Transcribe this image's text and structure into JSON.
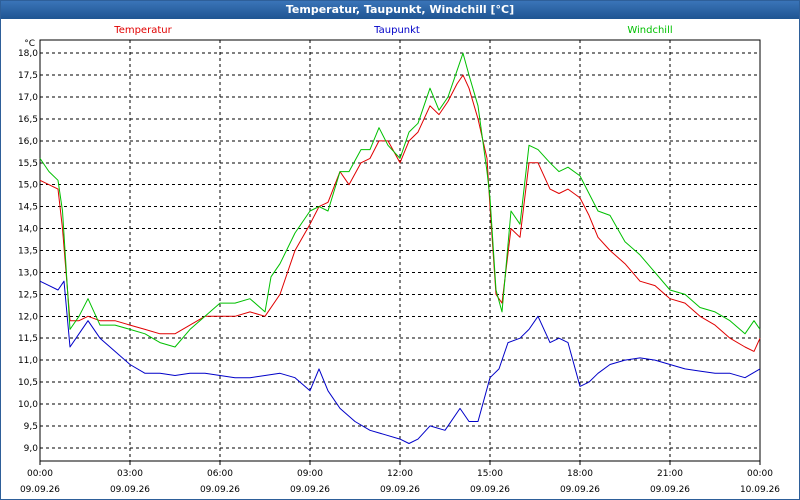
{
  "window": {
    "title": "Temperatur, Taupunkt, Windchill [°C]"
  },
  "chart_data": {
    "type": "line",
    "title": "Temperatur, Taupunkt, Windchill [°C]",
    "ylabel": "°C",
    "ylim": [
      8.7,
      18.3
    ],
    "yticks": [
      "9,0",
      "9,5",
      "10,0",
      "10,5",
      "11,0",
      "11,5",
      "12,0",
      "12,5",
      "13,0",
      "13,5",
      "14,0",
      "14,5",
      "15,0",
      "15,5",
      "16,0",
      "16,5",
      "17,0",
      "17,5",
      "18,0"
    ],
    "xlim": [
      0,
      24
    ],
    "xticks": [
      {
        "hour": 0,
        "time": "00:00",
        "date": "09.09.26"
      },
      {
        "hour": 3,
        "time": "03:00",
        "date": "09.09.26"
      },
      {
        "hour": 6,
        "time": "06:00",
        "date": "09.09.26"
      },
      {
        "hour": 9,
        "time": "09:00",
        "date": "09.09.26"
      },
      {
        "hour": 12,
        "time": "12:00",
        "date": "09.09.26"
      },
      {
        "hour": 15,
        "time": "15:00",
        "date": "09.09.26"
      },
      {
        "hour": 18,
        "time": "18:00",
        "date": "09.09.26"
      },
      {
        "hour": 21,
        "time": "21:00",
        "date": "09.09.26"
      },
      {
        "hour": 24,
        "time": "00:00",
        "date": "10.09.26"
      }
    ],
    "grid": true,
    "legend_placement": "top",
    "series": [
      {
        "name": "Temperatur",
        "color": "#e00000",
        "x": [
          0,
          0.3,
          0.6,
          0.75,
          1.0,
          1.3,
          1.6,
          2.0,
          2.5,
          3.0,
          3.5,
          4.0,
          4.5,
          5.0,
          5.5,
          6.0,
          6.5,
          7.0,
          7.5,
          8.0,
          8.5,
          9.0,
          9.3,
          9.6,
          10.0,
          10.3,
          10.7,
          11.0,
          11.3,
          11.6,
          12.0,
          12.3,
          12.6,
          13.0,
          13.3,
          13.6,
          13.9,
          14.1,
          14.3,
          14.6,
          14.9,
          15.0,
          15.2,
          15.4,
          15.7,
          16.0,
          16.3,
          16.6,
          17.0,
          17.3,
          17.6,
          18.0,
          18.3,
          18.6,
          19.0,
          19.5,
          20.0,
          20.5,
          21.0,
          21.5,
          22.0,
          22.5,
          23.0,
          23.5,
          23.8,
          24.0
        ],
        "y": [
          15.1,
          15.0,
          14.9,
          14.0,
          11.9,
          11.9,
          12.0,
          11.9,
          11.9,
          11.8,
          11.7,
          11.6,
          11.6,
          11.8,
          12.0,
          12.0,
          12.0,
          12.1,
          12.0,
          12.5,
          13.5,
          14.1,
          14.5,
          14.6,
          15.3,
          15.0,
          15.5,
          15.6,
          16.0,
          16.0,
          15.5,
          16.0,
          16.2,
          16.8,
          16.6,
          16.9,
          17.3,
          17.5,
          17.2,
          16.5,
          15.6,
          14.5,
          12.5,
          12.3,
          14.0,
          13.8,
          15.5,
          15.5,
          14.9,
          14.8,
          14.9,
          14.7,
          14.3,
          13.8,
          13.5,
          13.2,
          12.8,
          12.7,
          12.4,
          12.3,
          12.0,
          11.8,
          11.5,
          11.3,
          11.2,
          11.5
        ]
      },
      {
        "name": "Taupunkt",
        "color": "#0000c8",
        "x": [
          0,
          0.3,
          0.6,
          0.8,
          1.0,
          1.3,
          1.6,
          2.0,
          2.5,
          3.0,
          3.5,
          4.0,
          4.5,
          5.0,
          5.5,
          6.0,
          6.5,
          7.0,
          7.5,
          8.0,
          8.5,
          9.0,
          9.3,
          9.6,
          10.0,
          10.5,
          11.0,
          11.5,
          12.0,
          12.3,
          12.6,
          13.0,
          13.5,
          14.0,
          14.3,
          14.6,
          15.0,
          15.3,
          15.6,
          16.0,
          16.3,
          16.6,
          17.0,
          17.3,
          17.6,
          18.0,
          18.3,
          18.6,
          19.0,
          19.5,
          20.0,
          20.5,
          21.0,
          21.5,
          22.0,
          22.5,
          23.0,
          23.5,
          24.0
        ],
        "y": [
          12.8,
          12.7,
          12.6,
          12.8,
          11.3,
          11.6,
          11.9,
          11.5,
          11.2,
          10.9,
          10.7,
          10.7,
          10.65,
          10.7,
          10.7,
          10.65,
          10.6,
          10.6,
          10.65,
          10.7,
          10.6,
          10.3,
          10.8,
          10.3,
          9.9,
          9.6,
          9.4,
          9.3,
          9.2,
          9.1,
          9.2,
          9.5,
          9.4,
          9.9,
          9.6,
          9.6,
          10.6,
          10.8,
          11.4,
          11.5,
          11.7,
          12.0,
          11.4,
          11.5,
          11.4,
          10.4,
          10.5,
          10.7,
          10.9,
          11.0,
          11.05,
          11.0,
          10.9,
          10.8,
          10.75,
          10.7,
          10.7,
          10.6,
          10.8
        ]
      },
      {
        "name": "Windchill",
        "color": "#00c000",
        "x": [
          0,
          0.3,
          0.6,
          0.75,
          1.0,
          1.3,
          1.6,
          2.0,
          2.5,
          3.0,
          3.5,
          4.0,
          4.5,
          5.0,
          5.5,
          6.0,
          6.5,
          7.0,
          7.5,
          7.7,
          8.0,
          8.5,
          9.0,
          9.3,
          9.6,
          10.0,
          10.3,
          10.7,
          11.0,
          11.3,
          11.6,
          12.0,
          12.3,
          12.6,
          13.0,
          13.3,
          13.6,
          13.9,
          14.1,
          14.3,
          14.6,
          14.9,
          15.0,
          15.2,
          15.4,
          15.7,
          16.0,
          16.3,
          16.6,
          17.0,
          17.3,
          17.6,
          18.0,
          18.3,
          18.6,
          19.0,
          19.5,
          20.0,
          20.5,
          21.0,
          21.5,
          22.0,
          22.5,
          23.0,
          23.5,
          23.8,
          24.0
        ],
        "y": [
          15.6,
          15.3,
          15.1,
          14.4,
          11.7,
          12.0,
          12.4,
          11.8,
          11.8,
          11.7,
          11.6,
          11.4,
          11.3,
          11.7,
          12.0,
          12.3,
          12.3,
          12.4,
          12.1,
          12.9,
          13.2,
          13.9,
          14.4,
          14.5,
          14.4,
          15.3,
          15.3,
          15.8,
          15.8,
          16.3,
          15.9,
          15.6,
          16.2,
          16.4,
          17.2,
          16.7,
          17.0,
          17.6,
          18.0,
          17.5,
          16.8,
          15.3,
          14.7,
          12.6,
          12.1,
          14.4,
          14.1,
          15.9,
          15.8,
          15.5,
          15.3,
          15.4,
          15.2,
          14.8,
          14.4,
          14.3,
          13.7,
          13.4,
          13.0,
          12.6,
          12.5,
          12.2,
          12.1,
          11.9,
          11.6,
          11.9,
          11.7
        ]
      }
    ]
  }
}
